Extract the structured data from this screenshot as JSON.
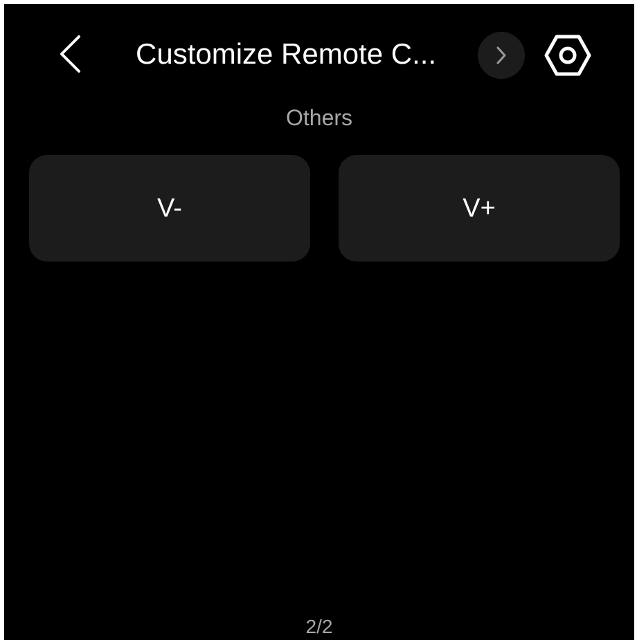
{
  "header": {
    "title": "Customize Remote C...",
    "back_icon": "chevron-left-icon",
    "next_icon": "chevron-right-icon",
    "settings_icon": "hexagon-settings-icon"
  },
  "section": {
    "label": "Others"
  },
  "buttons": [
    {
      "label": "V-"
    },
    {
      "label": "V+"
    }
  ],
  "pager": {
    "text": "2/2"
  },
  "colors": {
    "background": "#000000",
    "tile": "#1c1c1c",
    "text_primary": "#ffffff",
    "text_secondary": "#a8a8a8"
  }
}
